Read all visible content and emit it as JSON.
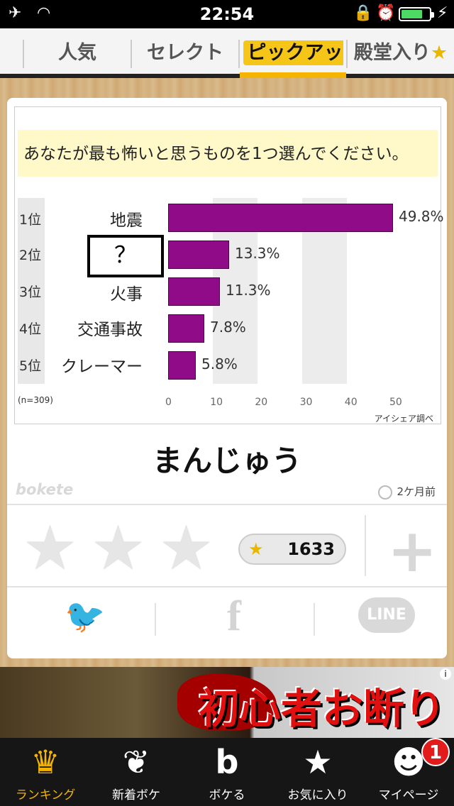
{
  "status_bar": {
    "time": "22:54",
    "icons": [
      "airplane-icon",
      "wifi-icon",
      "rotation-lock-icon",
      "alarm-icon",
      "battery-icon",
      "charging-icon"
    ]
  },
  "tabs": [
    {
      "label": "人気",
      "active": false
    },
    {
      "label": "セレクト",
      "active": false
    },
    {
      "label": "ピックアップ",
      "active": true
    },
    {
      "label": "殿堂入り",
      "active": false,
      "suffix": "★"
    }
  ],
  "post": {
    "question": "あなたが最も怖いと思うものを1つ選んでください。",
    "ranks": [
      "1位",
      "2位",
      "3位",
      "4位",
      "5位"
    ],
    "labels": [
      "地震",
      "？",
      "火事",
      "交通事故",
      "クレーマー"
    ],
    "percent_labels": [
      "49.8%",
      "13.3%",
      "11.3%",
      "7.8%",
      "5.8%"
    ],
    "n_label": "(n=309)",
    "x_ticks": [
      "0",
      "10",
      "20",
      "30",
      "40",
      "50"
    ],
    "source": "アイシェア調べ",
    "answer": "まんじゅう",
    "brand": "bokete",
    "time_ago": "2ケ月前",
    "rating_count": "1633"
  },
  "chart_data": {
    "type": "bar",
    "categories": [
      "地震",
      "？",
      "火事",
      "交通事故",
      "クレーマー"
    ],
    "values": [
      49.8,
      13.3,
      11.3,
      7.8,
      5.8
    ],
    "title": "あなたが最も怖いと思うものを1つ選んでください。",
    "xlim": [
      0,
      50
    ],
    "bar_color": "#8f0b88"
  },
  "share": {
    "twitter": "twitter-icon",
    "facebook": "f",
    "line": "LINE"
  },
  "ad": {
    "text": "初心者お断り",
    "info": "i"
  },
  "bottom_nav": [
    {
      "label": "ランキング",
      "icon": "crown-icon",
      "active": true
    },
    {
      "label": "新着ボケ",
      "icon": "sprout-icon",
      "active": false
    },
    {
      "label": "ボケる",
      "icon": "b-logo-icon",
      "active": false
    },
    {
      "label": "お気に入り",
      "icon": "star-icon",
      "active": false
    },
    {
      "label": "マイページ",
      "icon": "user-icon",
      "active": false
    }
  ],
  "badge_count": "1",
  "colors": {
    "accent": "#f5b400",
    "bar": "#8f0b88",
    "badge": "#e21b1b"
  }
}
